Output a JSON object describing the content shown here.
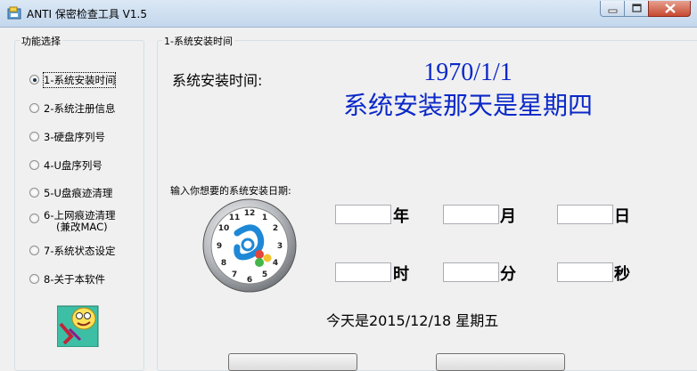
{
  "window": {
    "title": "ANTI 保密检查工具 V1.5",
    "icons": {
      "app": "app-icon",
      "minimize": "minimize-icon",
      "maximize": "maximize-icon",
      "close": "close-icon"
    }
  },
  "sidebar": {
    "legend": "功能选择",
    "items": [
      {
        "label": "1-系统安装时间",
        "selected": true
      },
      {
        "label": "2-系统注册信息",
        "selected": false
      },
      {
        "label": "3-硬盘序列号",
        "selected": false
      },
      {
        "label": "4-U盘序列号",
        "selected": false
      },
      {
        "label": "5-U盘痕迹清理",
        "selected": false
      },
      {
        "label": "6-上网痕迹清理",
        "label_line2": "(兼改MAC)",
        "selected": false
      },
      {
        "label": "7-系统状态设定",
        "selected": false
      },
      {
        "label": "8-关于本软件",
        "selected": false
      }
    ]
  },
  "main": {
    "legend": "1-系统安装时间",
    "install_label": "系统安装时间:",
    "install_date": "1970/1/1",
    "install_weekday": "系统安装那天是星期四",
    "prompt": "输入你想要的系统安装日期:",
    "fields": [
      {
        "unit": "年",
        "value": ""
      },
      {
        "unit": "月",
        "value": ""
      },
      {
        "unit": "日",
        "value": ""
      },
      {
        "unit": "时",
        "value": ""
      },
      {
        "unit": "分",
        "value": ""
      },
      {
        "unit": "秒",
        "value": ""
      }
    ],
    "today": "今天是2015/12/18  星期五",
    "clock_numbers": [
      "12",
      "1",
      "2",
      "3",
      "4",
      "5",
      "6",
      "7",
      "8",
      "9",
      "10",
      "11"
    ]
  },
  "colors": {
    "accent_text": "#0b28c8",
    "titlebar": "#c3d7ec",
    "close_button": "#c7492f"
  }
}
